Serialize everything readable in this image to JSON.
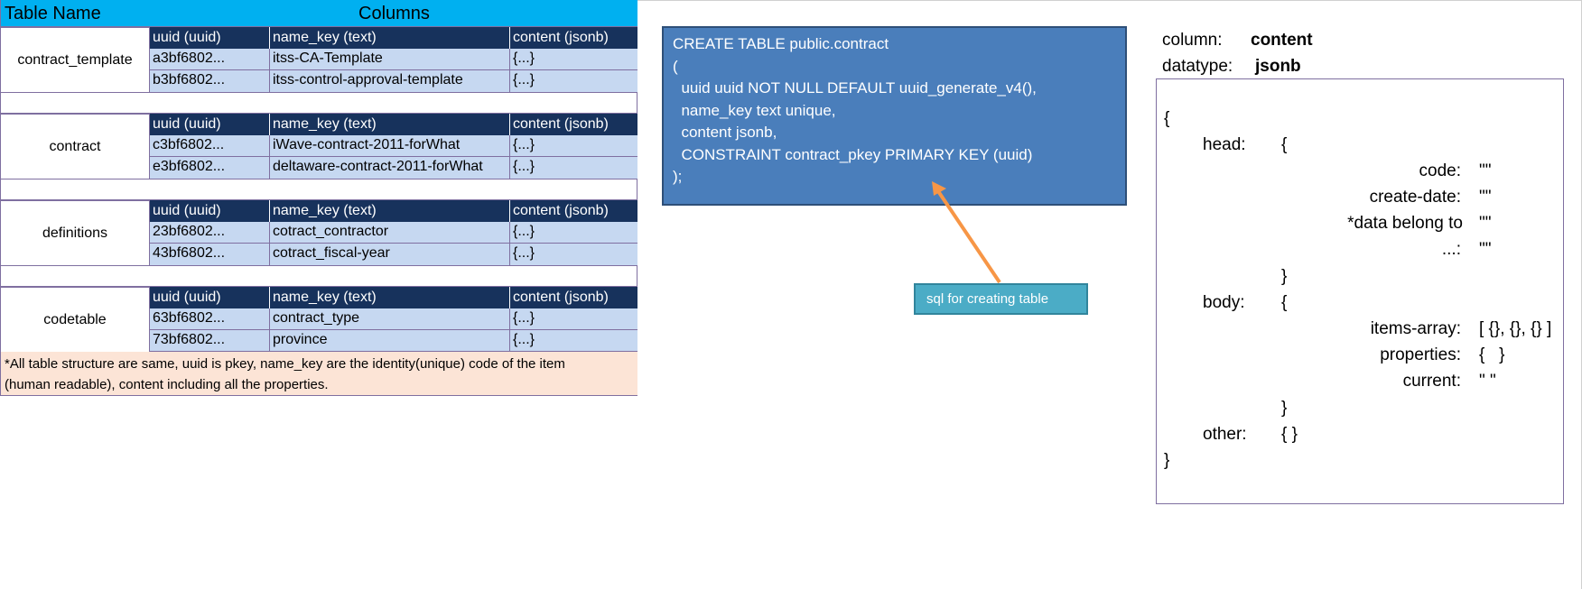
{
  "header": {
    "table_name": "Table Name",
    "columns": "Columns"
  },
  "column_headers": [
    "uuid (uuid)",
    "name_key (text)",
    "content (jsonb)"
  ],
  "groups": [
    {
      "name": "contract_template",
      "rows": [
        [
          "a3bf6802...",
          "itss-CA-Template",
          "{...}"
        ],
        [
          "b3bf6802...",
          "itss-control-approval-template",
          "{...}"
        ]
      ]
    },
    {
      "name": "contract",
      "rows": [
        [
          "c3bf6802...",
          "iWave-contract-2011-forWhat",
          "{...}"
        ],
        [
          "e3bf6802...",
          "deltaware-contract-2011-forWhat",
          "{...}"
        ]
      ]
    },
    {
      "name": "definitions",
      "rows": [
        [
          "23bf6802...",
          "cotract_contractor",
          "{...}"
        ],
        [
          "43bf6802...",
          "cotract_fiscal-year",
          "{...}"
        ]
      ]
    },
    {
      "name": "codetable",
      "rows": [
        [
          "63bf6802...",
          "contract_type",
          "{...}"
        ],
        [
          "73bf6802...",
          "province",
          "{...}"
        ]
      ]
    }
  ],
  "note": {
    "line1": "*All table structure are same, uuid is pkey, name_key are the identity(unique) code of the item",
    "line2": "(human readable), content including all the properties."
  },
  "sql": {
    "lines": [
      "CREATE TABLE public.contract",
      "(",
      "  uuid uuid NOT NULL DEFAULT uuid_generate_v4(),",
      "  name_key text unique,",
      "  content jsonb,",
      "  CONSTRAINT contract_pkey PRIMARY KEY (uuid)",
      ");"
    ]
  },
  "callout": {
    "text": "sql for creating table"
  },
  "column_info": {
    "column_label": "column:",
    "column_value": "content",
    "datatype_label": "datatype:",
    "datatype_value": "jsonb"
  },
  "json_structure": {
    "open": "{",
    "close": "}",
    "head_key": "head:",
    "head_open": "{",
    "head_close": "}",
    "head_fields": [
      {
        "key": "code:",
        "value": "\"\""
      },
      {
        "key": "create-date:",
        "value": "\"\""
      },
      {
        "key": "*data belong to",
        "value": "\"\""
      },
      {
        "key": "...:",
        "value": "\"\""
      }
    ],
    "body_key": "body:",
    "body_open": "{",
    "body_close": "}",
    "body_fields": [
      {
        "key": "items-array:",
        "value": "[ {}, {}, {} ]"
      },
      {
        "key": "properties:",
        "value": "{   }"
      },
      {
        "key": "current:",
        "value": "\" \""
      }
    ],
    "other_key": "other:",
    "other_value": "{ }"
  },
  "colors": {
    "header_bar": "#00b0f0",
    "column_header": "#17325c",
    "data_row": "#c6d8f1",
    "note_bg": "#fce4d6",
    "sql_box": "#4a7ebb",
    "callout": "#4bacc6",
    "arrow": "#f79646"
  }
}
